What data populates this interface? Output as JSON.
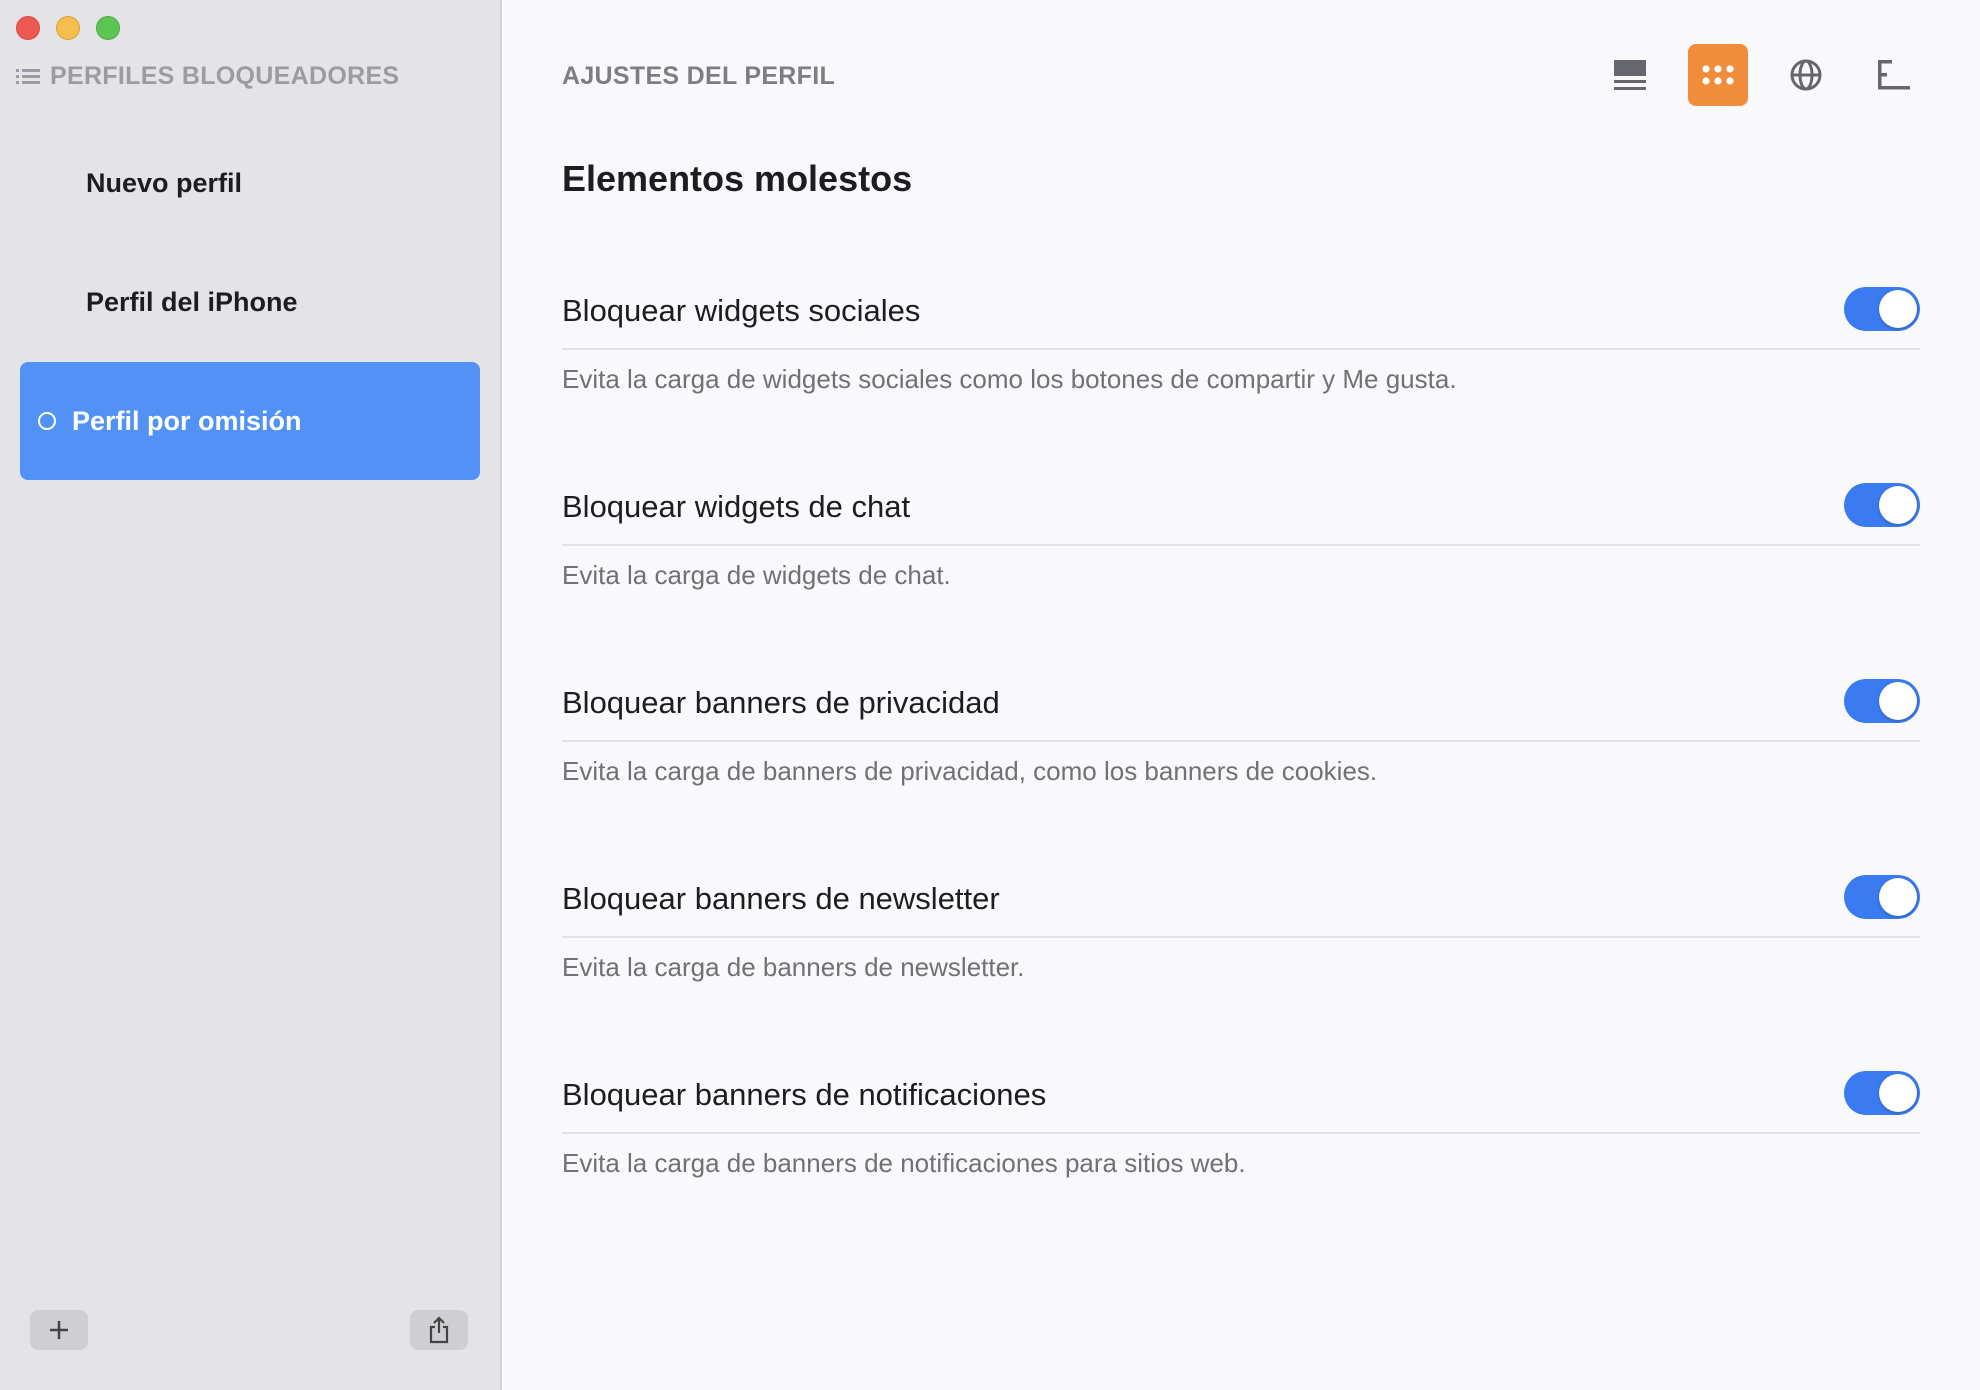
{
  "sidebar": {
    "header": "PERFILES BLOQUEADORES",
    "profiles": [
      {
        "label": "Nuevo perfil",
        "active": false
      },
      {
        "label": "Perfil del iPhone",
        "active": false
      },
      {
        "label": "Perfil por omisión",
        "active": true
      }
    ],
    "add_icon": "plus-icon",
    "share_icon": "share-icon"
  },
  "main": {
    "header": "AJUSTES DEL PERFIL",
    "toolbar": [
      {
        "icon": "list-view-icon",
        "active": false
      },
      {
        "icon": "grid-dots-icon",
        "active": true,
        "color": "#f08d3a"
      },
      {
        "icon": "globe-icon",
        "active": false
      },
      {
        "icon": "outline-icon",
        "active": false
      }
    ],
    "section_title": "Elementos molestos",
    "settings": [
      {
        "title": "Bloquear widgets sociales",
        "description": "Evita la carga de widgets sociales como los botones de compartir y Me gusta.",
        "enabled": true
      },
      {
        "title": "Bloquear widgets de chat",
        "description": "Evita la carga de widgets de chat.",
        "enabled": true
      },
      {
        "title": "Bloquear banners de privacidad",
        "description": "Evita la carga de banners de privacidad, como los banners de cookies.",
        "enabled": true
      },
      {
        "title": "Bloquear banners de newsletter",
        "description": "Evita la carga de banners de newsletter.",
        "enabled": true
      },
      {
        "title": "Bloquear banners de notificaciones",
        "description": "Evita la carga de banners de notificaciones para sitios web.",
        "enabled": true
      }
    ]
  },
  "colors": {
    "accent": "#5291f5",
    "toggle_on": "#3a7bf1",
    "toolbar_active": "#f08d3a"
  }
}
